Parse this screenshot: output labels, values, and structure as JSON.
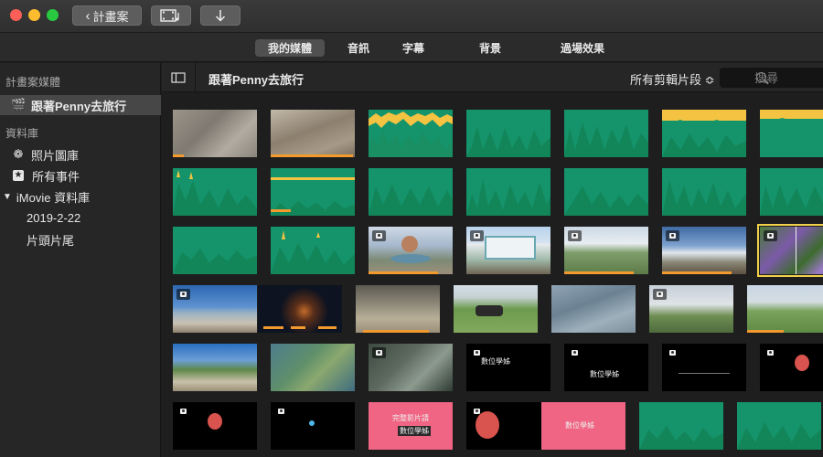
{
  "toolbar": {
    "back_label": "計畫案",
    "media_icon": "film-music-icon",
    "import_icon": "download-arrow-icon"
  },
  "tabs": [
    {
      "label": "我的媒體",
      "active": true
    },
    {
      "label": "音訊",
      "active": false
    },
    {
      "label": "字幕",
      "active": false
    },
    {
      "label": "背景",
      "active": false
    },
    {
      "label": "過場效果",
      "active": false
    }
  ],
  "sidebar": {
    "projects_heading": "計畫案媒體",
    "project_item": "跟著Penny去旅行",
    "library_heading": "資料庫",
    "library_items": [
      {
        "label": "照片圖庫",
        "icon": "flower-icon"
      },
      {
        "label": "所有事件",
        "icon": "star-icon"
      }
    ],
    "imovie_library": "iMovie 資料庫",
    "events": [
      "2019-2-22",
      "片頭片尾"
    ]
  },
  "browser": {
    "title": "跟著Penny去旅行",
    "filter_label": "所有剪輯片段 ≎",
    "search_placeholder": "搜尋"
  },
  "colors": {
    "audio_green": "#15936a",
    "audio_yellow": "#f5c342",
    "orange_used": "#f29a2e",
    "pink_card": "#f06583",
    "selected_outline": "#f2d14a"
  },
  "clip_texts": {
    "r4c4": "數位學姊",
    "r4c5": "數位學姊",
    "r5c4_line1": "完整影片請",
    "r5c4_line2": "數位學姊",
    "r5c6": "數位學姊"
  }
}
